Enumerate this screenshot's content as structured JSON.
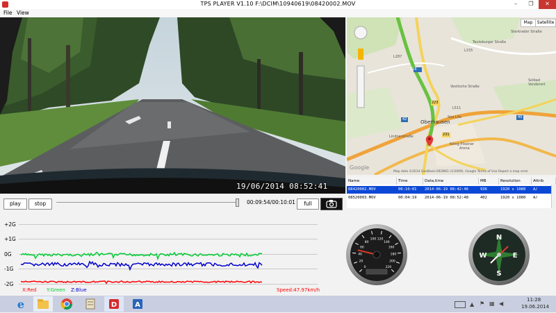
{
  "window": {
    "title": "TPS PLAYER V1.10   F:\\DCIM\\10940619\\08420002.MOV",
    "minimize": "–",
    "maximize": "❐",
    "close": "✕"
  },
  "menu": [
    "File",
    "View"
  ],
  "video": {
    "timestamp": "19/06/2014  08:52:41"
  },
  "map": {
    "tabs": [
      "Map",
      "Satellite"
    ],
    "city": "Oberhausen",
    "labels": {
      "sea_life": "Sea Life",
      "oberhausen": "Oberhausen",
      "koenig": "König Pilsener",
      "arena": "Arena",
      "lindnerstrasse": "Lindnerstraße",
      "teutoburger": "Teutoburger Straße",
      "sterkrader": "Sterkrader Straße",
      "gruenstrasse": "Grünstraße",
      "vestische": "Vestische Straße",
      "solbad": "Solbad\nVonderort",
      "l155": "L155",
      "l511": "L511",
      "l287": "L287",
      "r42": "42",
      "r516": "516",
      "r223": "223",
      "r231": "231",
      "r40": "40"
    },
    "attribution": "Map data ©2014 GeoBasis-DE/BKG (©2009), Google   Terms of Use   Report a map error",
    "google_logo": "Google"
  },
  "files": {
    "columns": [
      "Name",
      "Time",
      "Data,time",
      "MB",
      "Resolution",
      "Attrib"
    ],
    "rows": [
      {
        "name": "08420002.MOV",
        "time": "00:10:01",
        "datetime": "2014-06-19 08:42:46",
        "mb": "936",
        "resolution": "1920 x 1080",
        "attrib": "A/"
      },
      {
        "name": "08520003.MOV",
        "time": "00:04:19",
        "datetime": "2014-06-19 08:52:48",
        "mb": "402",
        "resolution": "1920 x 1080",
        "attrib": "A/"
      }
    ],
    "selected_index": 0
  },
  "controls": {
    "play": "play",
    "stop": "stop",
    "time": "00:09:54/00:10:01",
    "full": "full",
    "progress": 0.989
  },
  "graph": {
    "levels": [
      "+2G",
      "+1G",
      "0G",
      "-1G",
      "-2G"
    ],
    "legend": {
      "x": "X:Red",
      "y": "Y:Green",
      "z": "Z:Blue"
    },
    "speed": "Speed:47.97km/h",
    "colors": {
      "x": "#ff0000",
      "y": "#00cc33",
      "z": "#0000cc"
    }
  },
  "gauges": {
    "speedometer_ticks": [
      "0",
      "20",
      "40",
      "60",
      "80",
      "100",
      "120",
      "140",
      "160",
      "180",
      "200",
      "220"
    ],
    "compass_letters": [
      "N",
      "E",
      "S",
      "W"
    ],
    "speed_kmh": 47.97
  },
  "taskbar": {
    "clock_time": "11:28",
    "clock_date": "19.06.2014",
    "apps": [
      "ie-icon",
      "explorer-icon",
      "chrome-icon",
      "paint-icon",
      "tps-player-icon",
      "app-icon"
    ]
  }
}
